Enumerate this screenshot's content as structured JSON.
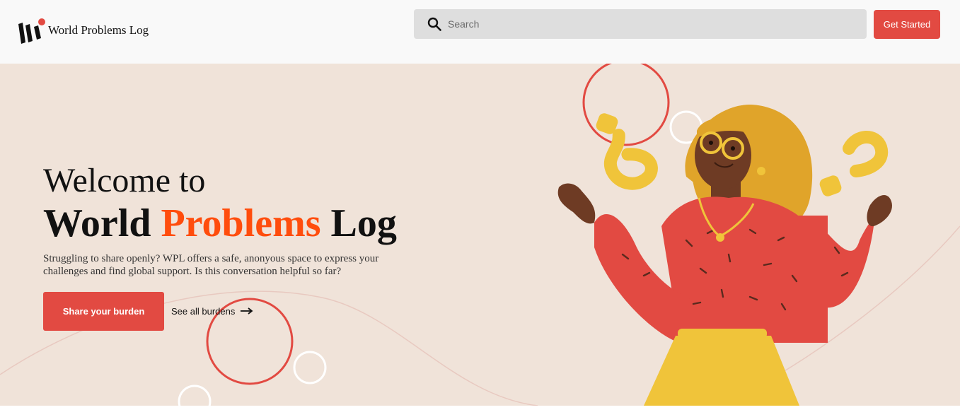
{
  "header": {
    "brand": "World Problems Log",
    "search_placeholder": "Search",
    "get_started_label": "Get Started"
  },
  "hero": {
    "welcome": "Welcome to",
    "title_part1": "World ",
    "title_accent": "Problems",
    "title_part2": " Log",
    "description": "Struggling to share openly? WPL offers a safe, anonyous space to express your challenges and find global support. Is this conversation helpful so far?",
    "share_label": "Share your burden",
    "see_all_label": "See all burdens"
  },
  "icons": {
    "logo": "wpl-logo-icon",
    "search": "search-icon",
    "arrow": "arrow-right-icon"
  },
  "colors": {
    "accent": "#e24a42",
    "title_accent": "#ff4d0d",
    "hero_bg": "#f0e3d9",
    "header_bg": "#f9f9f9",
    "search_bg": "#dedede"
  }
}
